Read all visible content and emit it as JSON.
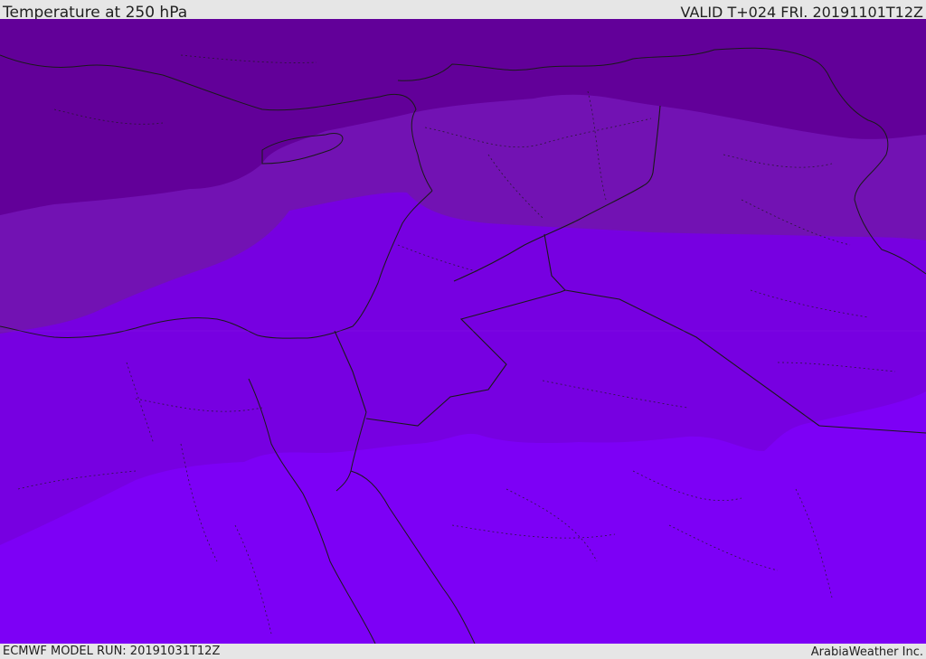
{
  "header": {
    "title": "Temperature at 250 hPa",
    "valid": "VALID T+024 FRI. 20191101T12Z"
  },
  "footer": {
    "model_run": "ECMWF MODEL RUN: 20191031T12Z",
    "credit": "ArabiaWeather Inc."
  },
  "map": {
    "band_colors": {
      "coldest": "#620099",
      "cold": "#7212b3",
      "mid": "#7700e1",
      "warm": "#7d00f6"
    },
    "line_color": "#1a1a1a"
  }
}
